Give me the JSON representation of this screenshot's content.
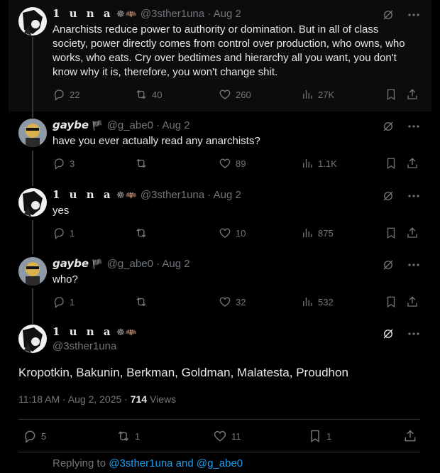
{
  "tweets": [
    {
      "name": "1 u n a",
      "badges": "☸🦇",
      "handle": "@3sther1una",
      "date": "Aug 2",
      "text": "Anarchists reduce power to authority or domination. But in all of class society, power directly comes from control over production, who owns, who works, who eats. Cry over bedtimes and hierarchy all you want, you don't know why it is, therefore, you won't change shit.",
      "replies": "22",
      "reposts": "40",
      "likes": "260",
      "views": "27K"
    },
    {
      "name": "gaybe",
      "badges": "🏴",
      "handle": "@g_abe0",
      "date": "Aug 2",
      "text": "have you ever actually read any anarchists?",
      "replies": "3",
      "reposts": "",
      "likes": "89",
      "views": "1.1K"
    },
    {
      "name": "1 u n a",
      "badges": "☸🦇",
      "handle": "@3sther1una",
      "date": "Aug 2",
      "text": "yes",
      "replies": "1",
      "reposts": "",
      "likes": "10",
      "views": "875"
    },
    {
      "name": "gaybe",
      "badges": "🏴",
      "handle": "@g_abe0",
      "date": "Aug 2",
      "text": "who?",
      "replies": "1",
      "reposts": "",
      "likes": "32",
      "views": "532"
    }
  ],
  "main": {
    "name": "1 u n a",
    "badges": "☸🦇",
    "handle": "@3sther1una",
    "text": "Kropotkin, Bakunin, Berkman, Goldman, Malatesta, Proudhon",
    "time": "11:18 AM · Aug 2, 2025 · ",
    "views_count": "714",
    "views_label": " Views",
    "replies": "5",
    "reposts": "1",
    "likes": "11",
    "bookmarks": "1"
  },
  "reply_bar": {
    "prefix": "Replying to ",
    "targets": "@3sther1una and @g_abe0"
  },
  "icon_names": [
    "grok-icon",
    "more-icon",
    "reply-icon",
    "repost-icon",
    "like-icon",
    "views-icon",
    "bookmark-icon",
    "share-icon"
  ]
}
